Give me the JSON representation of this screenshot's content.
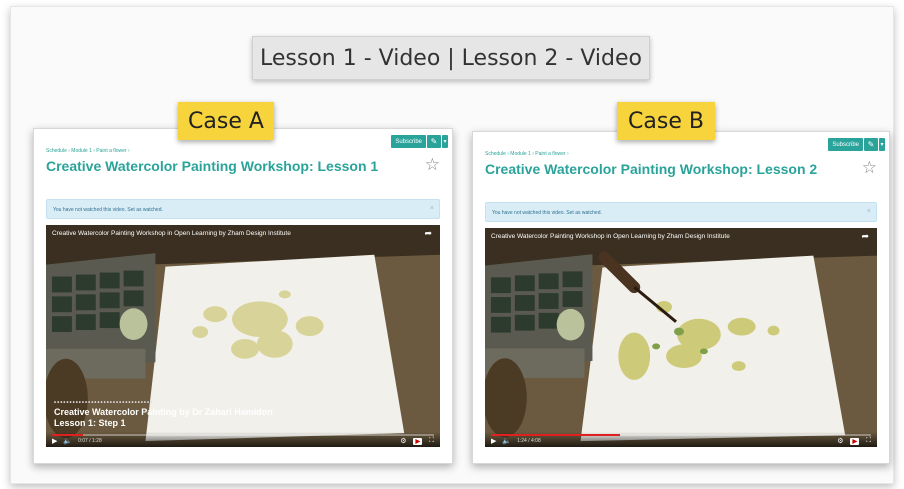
{
  "header": {
    "title": "Lesson 1 - Video | Lesson 2 - Video"
  },
  "cases": [
    {
      "label": "Case A",
      "toolbar": {
        "subscribe_label": "Subscribe"
      },
      "breadcrumb": "Schedule › Module 1 › Paint a flower ›",
      "title": "Creative Watercolor Painting Workshop: Lesson 1",
      "notice": "You have not watched this video. Set as watched.",
      "video": {
        "title": "Creative Watercolor Painting Workshop in Open Learning by Zham Design Institute",
        "overlay_line1": "Creative Watercolor Painting by Dr Zahari Hamidon",
        "overlay_line2": "Lesson 1: Step 1",
        "time": "0:07 / 1:28",
        "progress": 0.08
      }
    },
    {
      "label": "Case B",
      "toolbar": {
        "subscribe_label": "Subscribe"
      },
      "breadcrumb": "Schedule › Module 1 › Paint a flower ›",
      "title": "Creative Watercolor Painting Workshop: Lesson 2",
      "notice": "You have not watched this video. Set as watched.",
      "video": {
        "title": "Creative Watercolor Painting Workshop in Open Learning by Zham Design Institute",
        "time": "1:24 / 4:08",
        "progress": 0.34
      }
    }
  ],
  "icons": {
    "star": "star-outline-icon",
    "share": "share-arrow-icon",
    "play": "play-icon",
    "volume": "volume-icon",
    "settings": "gear-icon",
    "youtube": "youtube-logo",
    "fullscreen": "fullscreen-icon",
    "pencil": "pencil-icon",
    "close": "close-icon"
  },
  "colors": {
    "accent": "#2aa39a",
    "case_label": "#f7d33c",
    "progress": "#e02020"
  }
}
